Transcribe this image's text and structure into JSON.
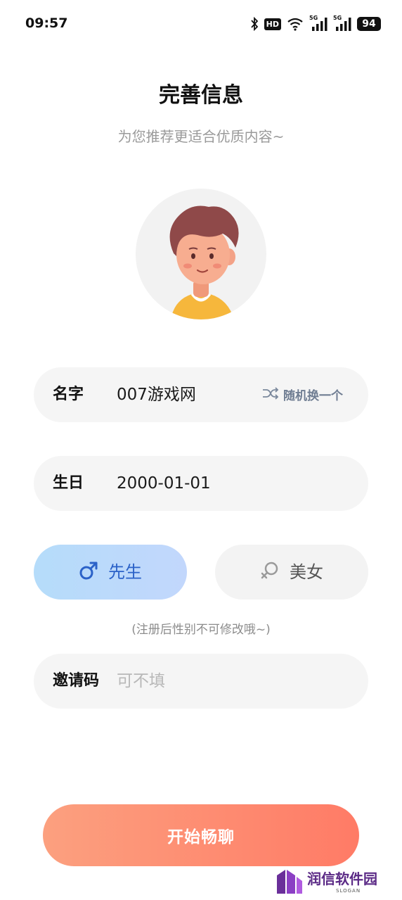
{
  "status_bar": {
    "time": "09:57",
    "hd_label": "HD",
    "network_label": "5G",
    "battery": "94",
    "icons": [
      "bluetooth-icon",
      "hd-icon",
      "wifi-icon",
      "signal-5g-icon",
      "signal-5g-icon",
      "battery-icon"
    ]
  },
  "header": {
    "title": "完善信息",
    "subtitle": "为您推荐更适合优质内容~"
  },
  "avatar": {
    "icon": "cartoon-boy-avatar"
  },
  "name_field": {
    "label": "名字",
    "value": "007游戏网",
    "random_label": "随机换一个",
    "random_icon": "shuffle-icon"
  },
  "birthday_field": {
    "label": "生日",
    "value": "2000-01-01"
  },
  "gender": {
    "male_label": "先生",
    "female_label": "美女",
    "selected": "male",
    "note": "(注册后性别不可修改哦~)"
  },
  "invite_field": {
    "label": "邀请码",
    "placeholder": "可不填"
  },
  "start_button": {
    "label": "开始畅聊"
  },
  "watermark": {
    "text": "润信软件园",
    "sub": "SLOGAN"
  },
  "colors": {
    "male_selected": "#2b62c8",
    "start_gradient_from": "#fca07f",
    "start_gradient_to": "#ff7b66",
    "field_bg": "#f5f5f5"
  }
}
